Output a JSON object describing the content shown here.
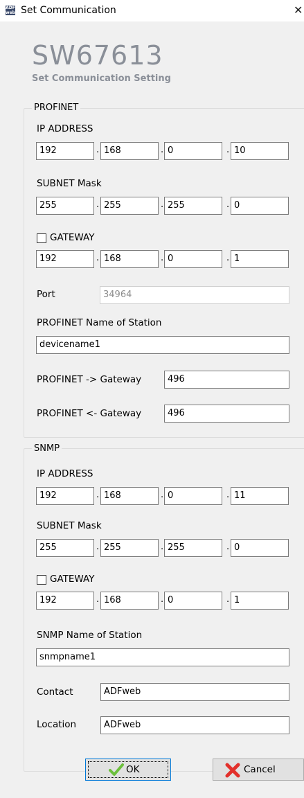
{
  "window": {
    "title": "Set Communication",
    "app_icon_text": "ADF web"
  },
  "header": {
    "product": "SW67613",
    "subtitle": "Set Communication Setting"
  },
  "profinet": {
    "legend": "PROFINET",
    "ip_label": "IP ADDRESS",
    "ip": [
      "192",
      "168",
      "0",
      "10"
    ],
    "subnet_label": "SUBNET Mask",
    "subnet": [
      "255",
      "255",
      "255",
      "0"
    ],
    "gateway_label": "GATEWAY",
    "gateway_checked": false,
    "gateway": [
      "192",
      "168",
      "0",
      "1"
    ],
    "port_label": "Port",
    "port": "34964",
    "name_label": "PROFINET Name of Station",
    "name": "devicename1",
    "to_gateway_label": "PROFINET -> Gateway",
    "to_gateway": "496",
    "from_gateway_label": "PROFINET <- Gateway",
    "from_gateway": "496"
  },
  "snmp": {
    "legend": "SNMP",
    "ip_label": "IP ADDRESS",
    "ip": [
      "192",
      "168",
      "0",
      "11"
    ],
    "subnet_label": "SUBNET Mask",
    "subnet": [
      "255",
      "255",
      "255",
      "0"
    ],
    "gateway_label": "GATEWAY",
    "gateway_checked": false,
    "gateway": [
      "192",
      "168",
      "0",
      "1"
    ],
    "name_label": "SNMP Name of Station",
    "name": "snmpname1",
    "contact_label": "Contact",
    "contact": "ADFweb",
    "location_label": "Location",
    "location": "ADFweb"
  },
  "buttons": {
    "ok": "OK",
    "cancel": "Cancel"
  },
  "colors": {
    "title_gray": "#8a8f98",
    "ok_check": "#6cbf3c",
    "cancel_x": "#e2302b",
    "focus_border": "#0078d7"
  }
}
